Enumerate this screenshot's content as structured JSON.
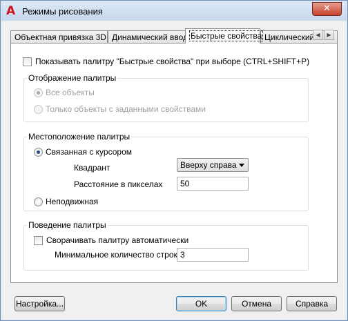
{
  "window": {
    "title": "Режимы рисования",
    "close_glyph": "✕",
    "app_icon": "autocad-a-icon"
  },
  "tabs": [
    {
      "label": "Объектная привязка 3D"
    },
    {
      "label": "Динамический ввод"
    },
    {
      "label": "Быстрые свойства",
      "active": true
    },
    {
      "label": "Циклический в"
    }
  ],
  "tab_scroll": {
    "left": "◀",
    "right": "▶"
  },
  "show_palette": {
    "checked": false,
    "label": "Показывать палитру \"Быстрые свойства\" при выборе (CTRL+SHIFT+P)"
  },
  "display_group": {
    "title": "Отображение палитры",
    "options": [
      {
        "label": "Все объекты",
        "checked": true,
        "enabled": false
      },
      {
        "label": "Только объекты с заданными свойствами",
        "checked": false,
        "enabled": false
      }
    ]
  },
  "location_group": {
    "title": "Местоположение палитры",
    "cursor_option": {
      "label": "Связанная с курсором",
      "checked": true
    },
    "quadrant_label": "Квадрант",
    "quadrant_value": "Вверху справа",
    "distance_label": "Расстояние в пикселах",
    "distance_value": "50",
    "fixed_option": {
      "label": "Неподвижная",
      "checked": false
    }
  },
  "behavior_group": {
    "title": "Поведение палитры",
    "collapse": {
      "label": "Сворачивать палитру автоматически",
      "checked": false
    },
    "min_rows_label": "Минимальное количество строк",
    "min_rows_value": "3"
  },
  "buttons": {
    "settings": "Настройка...",
    "ok": "OK",
    "cancel": "Отмена",
    "help": "Справка"
  },
  "colors": {
    "accent": "#3c7fb1",
    "title_gradient": "#c7d9ee"
  }
}
